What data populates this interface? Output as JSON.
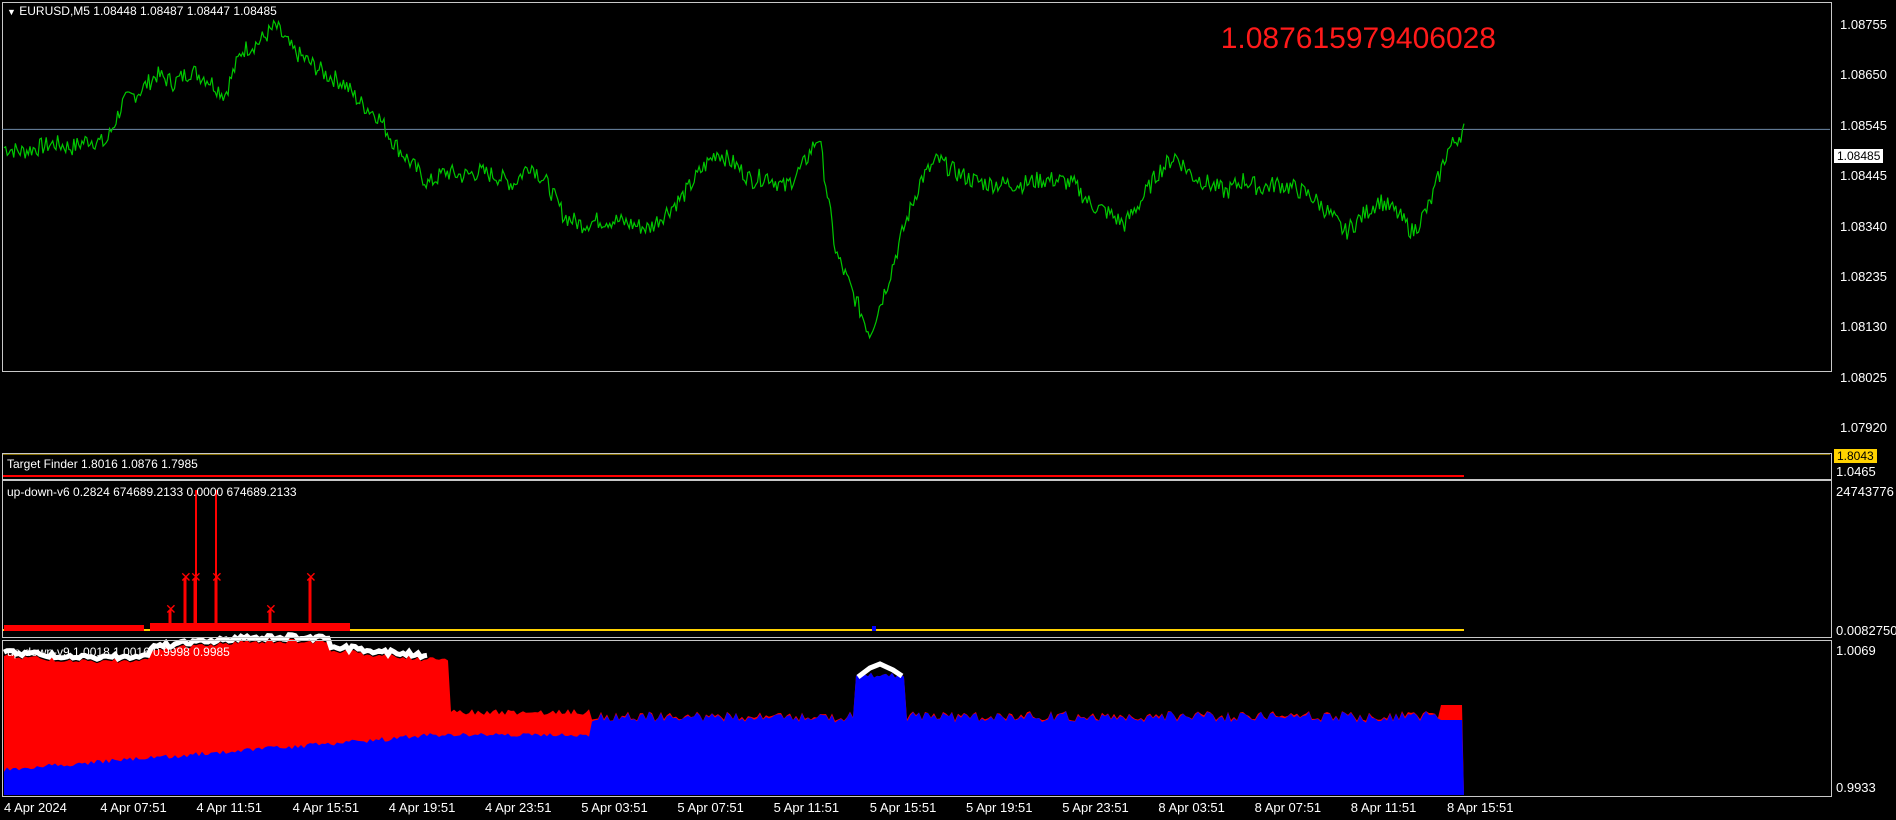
{
  "header": {
    "symbol_label": "EURUSD,M5  1.08448 1.08487 1.08447 1.08485",
    "big_value": "1.087615979406028"
  },
  "price_axis": {
    "ticks": [
      "1.08755",
      "1.08650",
      "1.08545",
      "1.08445",
      "1.08340",
      "1.08235",
      "1.08130",
      "1.08025",
      "1.07920"
    ],
    "current": "1.08485"
  },
  "pane_target": {
    "title": "Target Finder 1.8016 1.0876 1.7985",
    "value_tag": "1.8043",
    "axis_label": "1.0465"
  },
  "pane_v6": {
    "title": "up-down-v6 0.2824 674689.2133 0.0000 674689.2133",
    "axis_top": "24743776",
    "axis_bottom": "0.0082750"
  },
  "pane_v9": {
    "title": "up-down-v9 1.0018 1.0016 0.9998 0.9985",
    "axis_top": "1.0069",
    "axis_bottom": "0.9933"
  },
  "time_axis": {
    "labels": [
      "4 Apr 2024",
      "4 Apr 07:51",
      "4 Apr 11:51",
      "4 Apr 15:51",
      "4 Apr 19:51",
      "4 Apr 23:51",
      "5 Apr 03:51",
      "5 Apr 07:51",
      "5 Apr 11:51",
      "5 Apr 15:51",
      "5 Apr 19:51",
      "5 Apr 23:51",
      "8 Apr 03:51",
      "8 Apr 07:51",
      "8 Apr 11:51",
      "8 Apr 15:51"
    ]
  },
  "colors": {
    "price_line": "#00c800",
    "big_value": "#ff1a1a",
    "down_fill": "#ff0000",
    "up_fill": "#0000ff",
    "hline": "#6e8aa8",
    "level_line": "#ffd200"
  },
  "chart_data": {
    "type": "line",
    "series": [
      {
        "values": [
          1.0844,
          1.0843,
          1.0844,
          1.0845,
          1.0844,
          1.0846,
          1.0845,
          1.0855,
          1.0858,
          1.0862,
          1.086,
          1.0863,
          1.0861,
          1.0857,
          1.0868,
          1.087,
          1.0874,
          1.0868,
          1.0865,
          1.0862,
          1.086,
          1.0855,
          1.0852,
          1.0845,
          1.084,
          1.0835,
          1.0838,
          1.0837,
          1.0838,
          1.0837,
          1.0835,
          1.084,
          1.0835,
          1.0827,
          1.0825,
          1.0826,
          1.0826,
          1.0825,
          1.0824,
          1.0828,
          1.0832,
          1.0838,
          1.0843,
          1.084,
          1.0836,
          1.0837,
          1.0834,
          1.0839,
          1.0847,
          1.0818,
          1.0808,
          1.0798,
          1.081,
          1.0824,
          1.0836,
          1.0841,
          1.0838,
          1.0836,
          1.0835,
          1.0835,
          1.0835,
          1.0836,
          1.0836,
          1.0835,
          1.083,
          1.0828,
          1.0825,
          1.0831,
          1.0838,
          1.0842,
          1.0837,
          1.0835,
          1.0833,
          1.0836,
          1.0834,
          1.0835,
          1.0834,
          1.0832,
          1.0828,
          1.0823,
          1.0827,
          1.0831,
          1.0828,
          1.0823,
          1.083,
          1.0843,
          1.08485
        ]
      }
    ],
    "ylim": [
      1.0789,
      1.0879
    ]
  }
}
